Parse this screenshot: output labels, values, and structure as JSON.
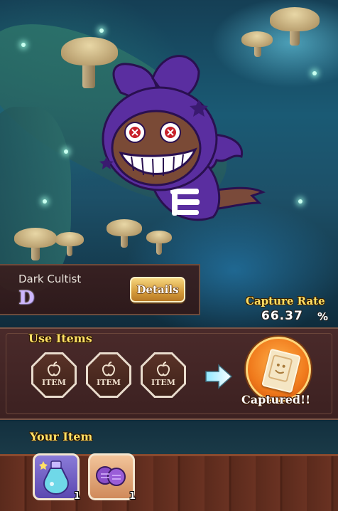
{
  "monster": {
    "name": "Dark Cultist",
    "rank": "D",
    "details_label": "Details"
  },
  "capture": {
    "rate_label": "Capture Rate",
    "rate_value": "66.37",
    "rate_unit": "%",
    "button_label": "Captured!!"
  },
  "use_items": {
    "title": "Use Items",
    "slots": [
      {
        "label": "ITEM",
        "icon": "apple-icon"
      },
      {
        "label": "ITEM",
        "icon": "apple-icon"
      },
      {
        "label": "ITEM",
        "icon": "apple-icon"
      }
    ]
  },
  "your_items": {
    "title": "Your Item",
    "items": [
      {
        "icon": "potion-bottle-icon",
        "count": "1"
      },
      {
        "icon": "purple-orbs-icon",
        "count": "1"
      }
    ]
  },
  "colors": {
    "title_yellow": "#ffe066",
    "panel_brown": "#3c2121",
    "capture_orange": "#f07a1c"
  }
}
